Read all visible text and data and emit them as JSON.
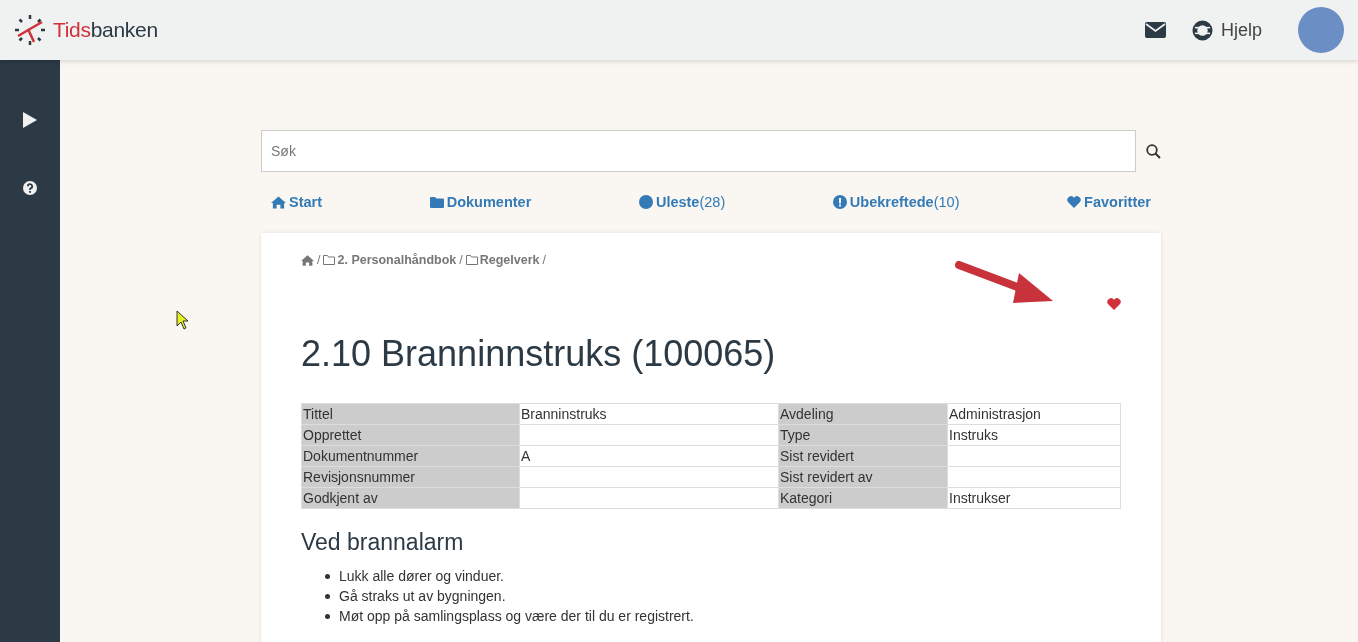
{
  "header": {
    "logo": {
      "part_1": "Tids",
      "part_2": "banken"
    },
    "help_label": "Hjelp"
  },
  "search": {
    "placeholder": "Søk"
  },
  "nav": [
    {
      "kind": "home",
      "label": "Start"
    },
    {
      "kind": "folder",
      "label": "Dokumenter"
    },
    {
      "kind": "circle",
      "label": "Uleste",
      "count": "(28)"
    },
    {
      "kind": "alert",
      "label": "Ubekreftede",
      "count": "(10)"
    },
    {
      "kind": "heart",
      "label": "Favoritter"
    }
  ],
  "breadcrumb": [
    {
      "kind": "home",
      "separator": "/"
    },
    {
      "kind": "folder",
      "label": "2. Personalhåndbok",
      "separator": "/"
    },
    {
      "kind": "folder",
      "label": "Regelverk",
      "separator": "/"
    }
  ],
  "document": {
    "title": "2.10 Branninnstruks (100065)",
    "favorite": true,
    "properties": [
      {
        "label_1": "Tittel",
        "value_1": "Branninstruks",
        "label_2": "Avdeling",
        "value_2": "Administrasjon"
      },
      {
        "label_1": "Opprettet",
        "label_2": "Type",
        "value_2": "Instruks"
      },
      {
        "label_1": "Dokumentnummer",
        "value_1": "A",
        "label_2": "Sist revidert"
      },
      {
        "label_1": "Revisjonsnummer",
        "label_2": "Sist revidert av"
      },
      {
        "label_1": "Godkjent av",
        "label_2": "Kategori",
        "value_2": "Instrukser"
      }
    ],
    "section_heading": "Ved brannalarm",
    "list": [
      "Lukk alle dører og vinduer.",
      "Gå straks ut av bygningen.",
      "Møt opp på samlingsplass og være der til du er registrert."
    ]
  }
}
